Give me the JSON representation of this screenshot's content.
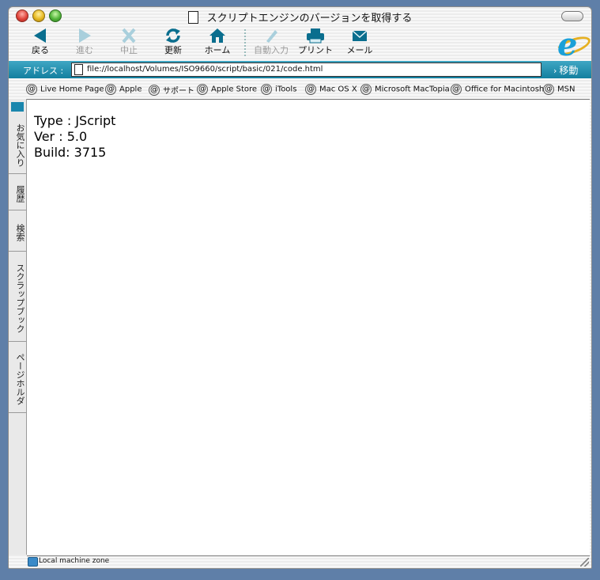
{
  "window": {
    "title": "スクリプトエンジンのバージョンを取得する"
  },
  "toolbar": {
    "buttons": [
      {
        "label": "戻る",
        "icon": "back-arrow-icon",
        "enabled": true
      },
      {
        "label": "進む",
        "icon": "forward-arrow-icon",
        "enabled": false
      },
      {
        "label": "中止",
        "icon": "stop-x-icon",
        "enabled": false
      },
      {
        "label": "更新",
        "icon": "refresh-icon",
        "enabled": true
      },
      {
        "label": "ホーム",
        "icon": "home-icon",
        "enabled": true
      },
      {
        "label": "自動入力",
        "icon": "autofill-pen-icon",
        "enabled": false
      },
      {
        "label": "プリント",
        "icon": "printer-icon",
        "enabled": true
      },
      {
        "label": "メール",
        "icon": "mail-icon",
        "enabled": true
      }
    ]
  },
  "address": {
    "label": "アドレス :",
    "url": "file://localhost/Volumes/ISO9660/script/basic/021/code.html",
    "go_label": "移動"
  },
  "favorites": [
    "Live Home Page",
    "Apple",
    "サポート",
    "Apple Store",
    "iTools",
    "Mac OS X",
    "Microsoft MacTopia",
    "Office for Macintosh",
    "MSN"
  ],
  "sidebar": {
    "tabs": [
      "お気に入り",
      "履歴",
      "検索",
      "スクラップブック",
      "ページホルダ"
    ]
  },
  "content": {
    "lines": [
      "Type : JScript",
      "Ver : 5.0",
      "Build: 3715"
    ]
  },
  "status": {
    "zone": "Local machine zone"
  },
  "colors": {
    "accent": "#137f9f",
    "icon": "#0a6e8e",
    "background": "#5f7fa8"
  }
}
